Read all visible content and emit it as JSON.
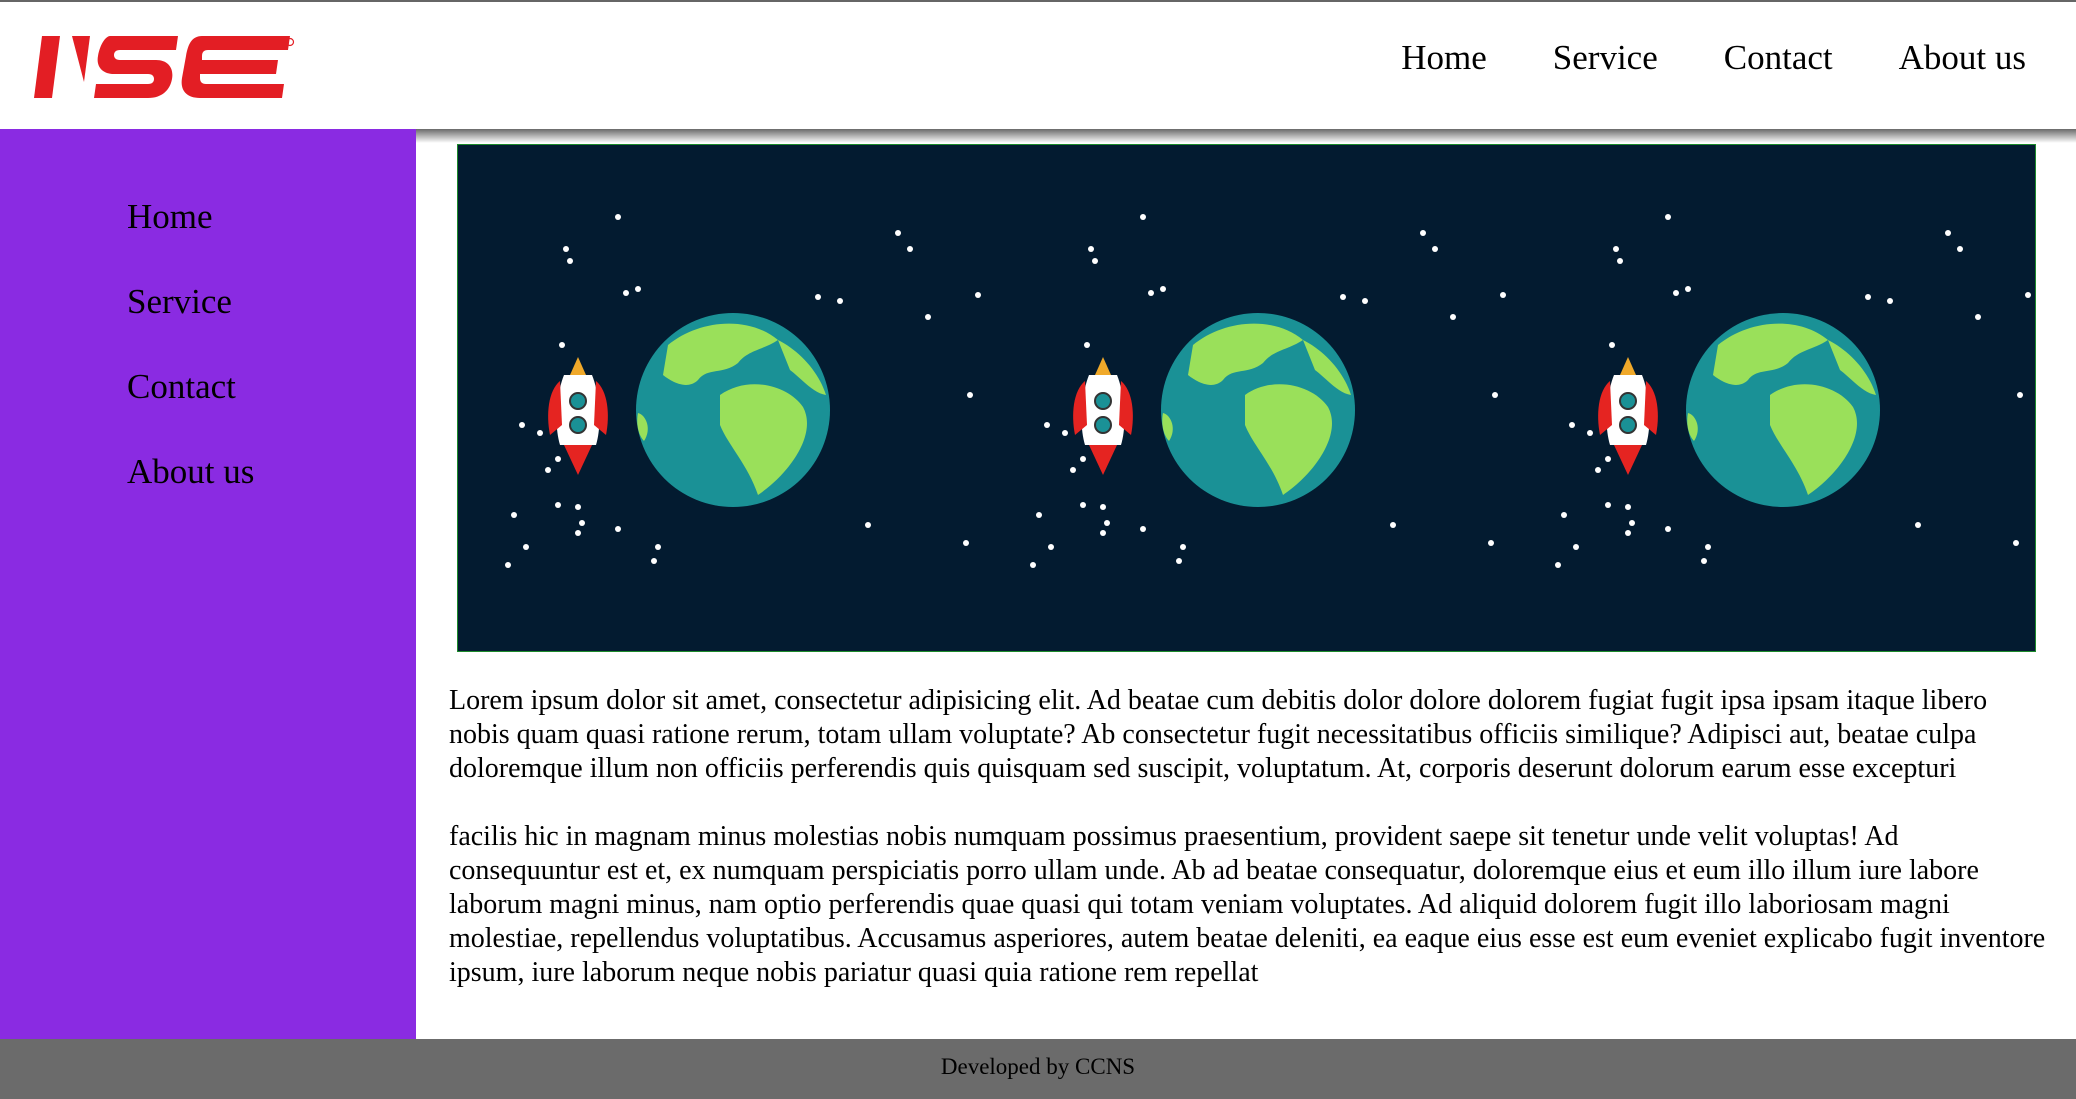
{
  "header": {
    "logo_text": "IJSE",
    "nav": [
      "Home",
      "Service",
      "Contact",
      "About us"
    ]
  },
  "sidebar": {
    "nav": [
      "Home",
      "Service",
      "Contact",
      "About us"
    ]
  },
  "gallery": {
    "tiles": [
      "rocket-earth-illustration",
      "rocket-earth-illustration",
      "rocket-earth-illustration"
    ]
  },
  "main": {
    "paragraphs": [
      "Lorem ipsum dolor sit amet, consectetur adipisicing elit. Ad beatae cum debitis dolor dolore dolorem fugiat fugit ipsa ipsam itaque libero nobis quam quasi ratione rerum, totam ullam voluptate? Ab consectetur fugit necessitatibus officiis similique? Adipisci aut, beatae culpa doloremque illum non officiis perferendis quis quisquam sed suscipit, voluptatum. At, corporis deserunt dolorum earum esse excepturi",
      "facilis hic in magnam minus molestias nobis numquam possimus praesentium, provident saepe sit tenetur unde velit voluptas! Ad consequuntur est et, ex numquam perspiciatis porro ullam unde. Ab ad beatae consequatur, doloremque eius et eum illo illum iure labore laborum magni minus, nam optio perferendis quae quasi qui totam veniam voluptates. Ad aliquid dolorem fugit illo laboriosam magni molestiae, repellendus voluptatibus. Accusamus asperiores, autem beatae deleniti, ea eaque eius esse est eum eveniet explicabo fugit inventore ipsum, iure laborum neque nobis pariatur quasi quia ratione rem repellat"
    ]
  },
  "footer": {
    "text": "Developed by CCNS"
  },
  "colors": {
    "sidebar": "#8a2be2",
    "footer": "#6b6b6b",
    "logo_red": "#e31e24",
    "space_bg": "#031b30"
  }
}
